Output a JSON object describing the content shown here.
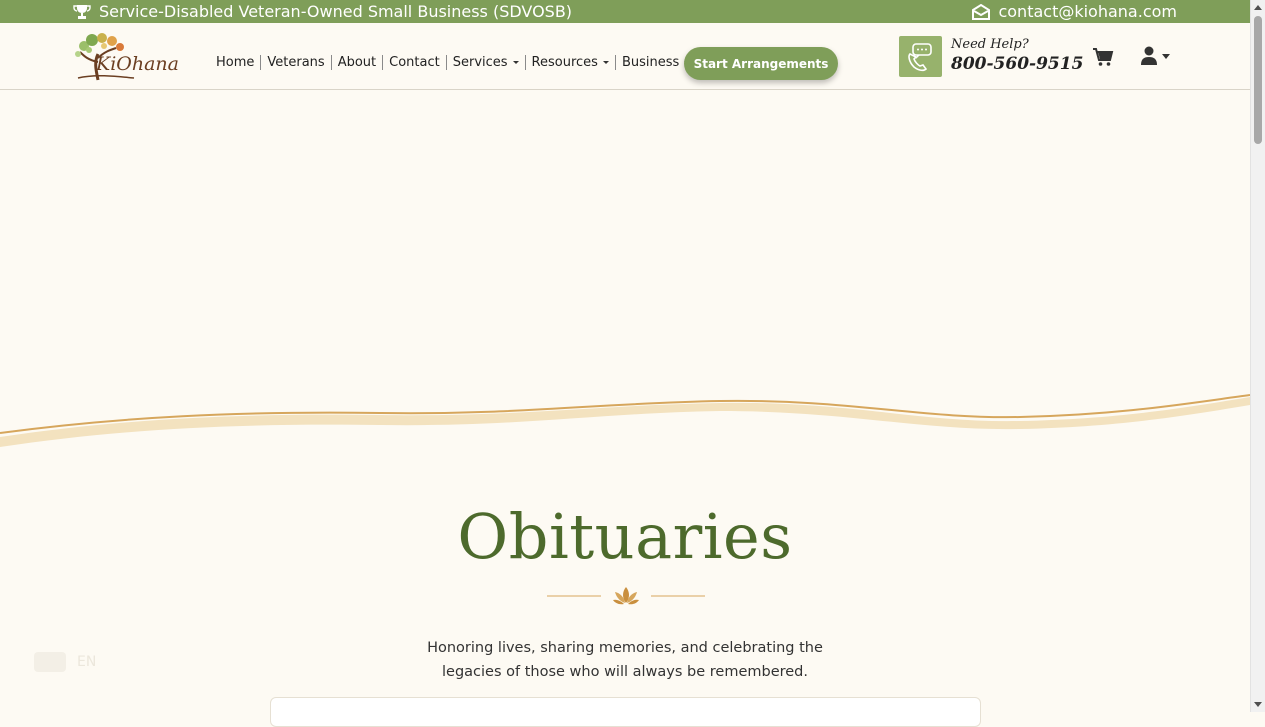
{
  "topbar": {
    "badge_text": "Service-Disabled Veteran-Owned Small Business (SDVOSB)",
    "email": "contact@kiohana.com",
    "background": "#7f9e59"
  },
  "header": {
    "logo_text": "KiOhana",
    "nav": [
      {
        "label": "Home"
      },
      {
        "label": "Veterans"
      },
      {
        "label": "About"
      },
      {
        "label": "Contact"
      },
      {
        "label": "Services"
      },
      {
        "label": "Resources"
      },
      {
        "label": "Business"
      }
    ],
    "cta_label": "Start Arrangements",
    "need_help": "Need Help?",
    "phone": "800-560-9515",
    "icons": {
      "cart": "cart-icon",
      "user": "user-icon",
      "help": "phone-chat-icon",
      "trophy": "trophy-icon",
      "email": "envelope-icon"
    }
  },
  "main": {
    "title": "Obituaries",
    "intro_line1": "Honoring lives, sharing memories, and celebrating the",
    "intro_line2": "legacies of those who will always be remembered.",
    "ghost_text": "EN"
  },
  "colors": {
    "accent": "#7f9e59",
    "title": "#4d6a2c",
    "gold": "#d6a65c",
    "background": "#fdfaf3"
  }
}
